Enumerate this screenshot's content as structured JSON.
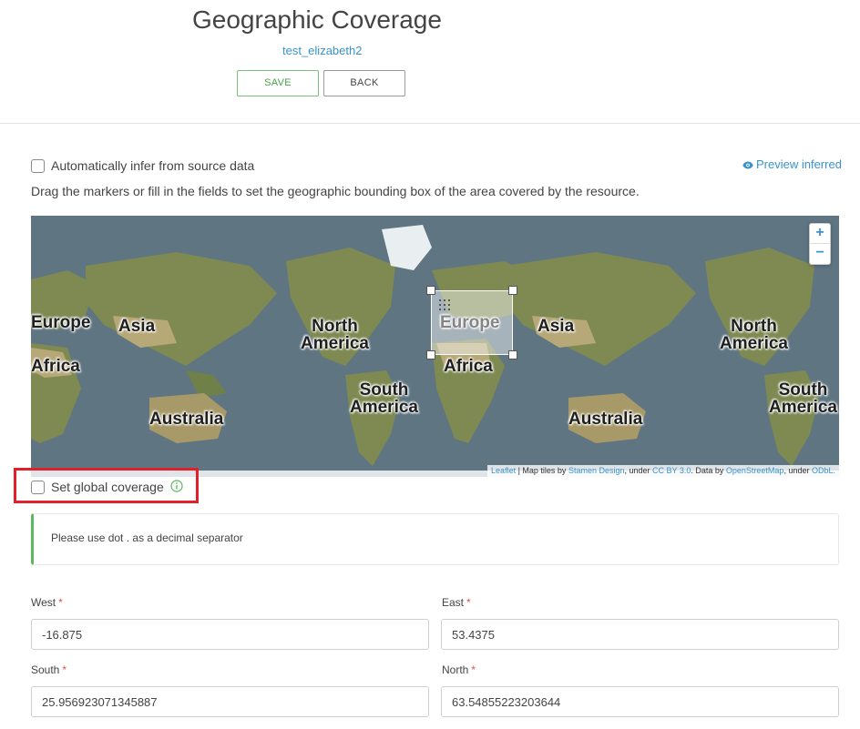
{
  "header": {
    "title": "Geographic Coverage",
    "subtitle": "test_elizabeth2",
    "save_label": "SAVE",
    "back_label": "BACK"
  },
  "auto_infer": {
    "label": "Automatically infer from source data",
    "checked": false,
    "preview_label": "Preview inferred"
  },
  "instructions": "Drag the markers or fill in the fields to set the geographic bounding box of the area covered by the resource.",
  "map": {
    "labels": {
      "europe_left": "Europe",
      "africa_left": "Africa",
      "asia_1": "Asia",
      "north_america_1": "North\nAmerica",
      "south_america_1": "South\nAmerica",
      "australia_1": "Australia",
      "europe_center": "Europe",
      "africa_center": "Africa",
      "asia_2": "Asia",
      "north_america_2": "North\nAmerica",
      "south_america_2": "South\nAmerica",
      "australia_2": "Australia"
    },
    "zoom_in": "+",
    "zoom_out": "−",
    "attribution": {
      "leaflet": "Leaflet",
      "sep1": " | Map tiles by ",
      "stamen": "Stamen Design",
      "sep2": ", under ",
      "ccby": "CC BY 3.0",
      "sep3": ". Data by ",
      "osm": "OpenStreetMap",
      "sep4": ", under ",
      "odbl": "ODbL."
    },
    "colors": {
      "ocean": "#5f7582",
      "land": "#7e8a52",
      "desert": "#b7a878",
      "ice": "#e9eef0"
    }
  },
  "global_coverage": {
    "label": "Set global coverage",
    "checked": false
  },
  "notice": "Please use dot . as a decimal separator",
  "fields": {
    "west": {
      "label": "West",
      "value": "-16.875"
    },
    "east": {
      "label": "East",
      "value": "53.4375"
    },
    "south": {
      "label": "South",
      "value": "25.956923071345887"
    },
    "north": {
      "label": "North",
      "value": "63.54855223203644"
    },
    "required_mark": "*"
  }
}
